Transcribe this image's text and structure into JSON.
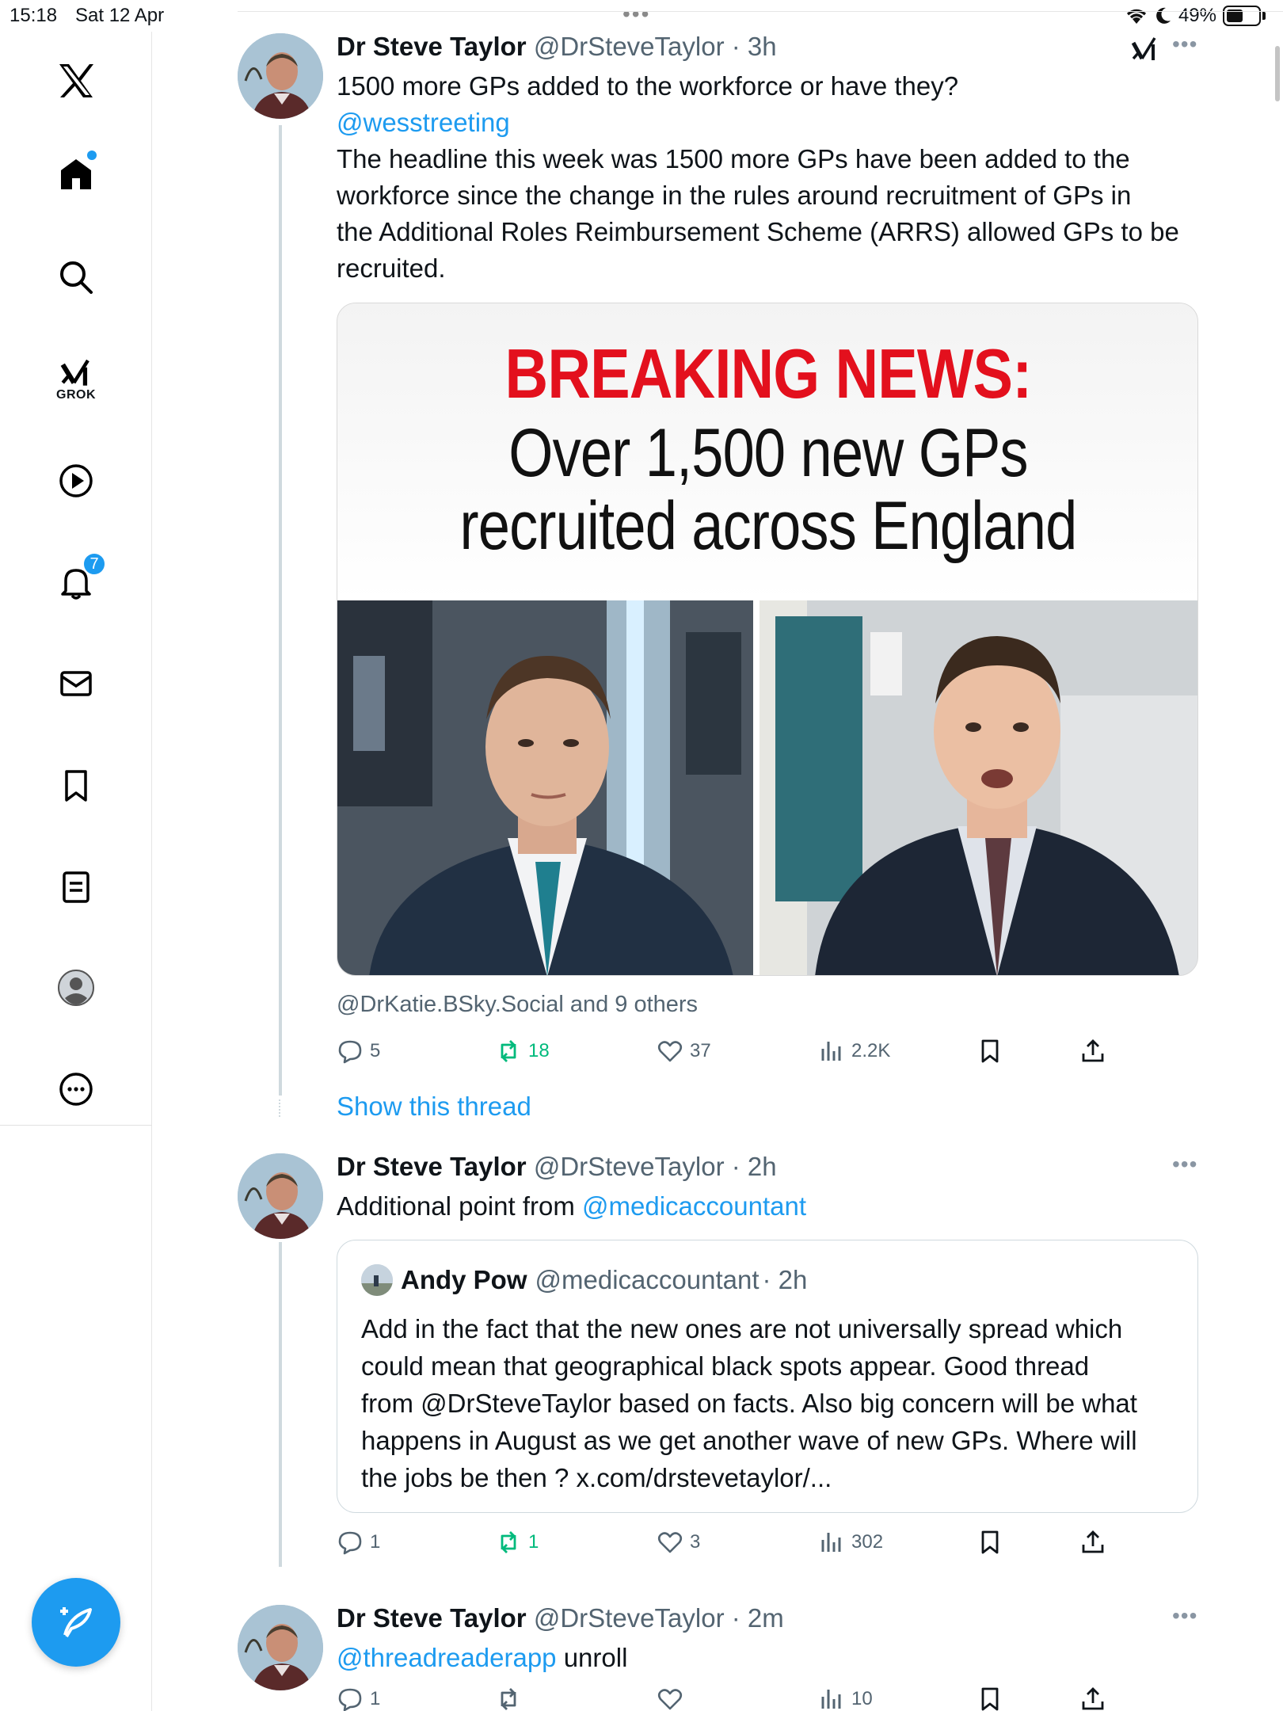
{
  "status_bar": {
    "time": "15:18",
    "date": "Sat 12 Apr",
    "battery": "49%"
  },
  "sidebar": {
    "grok_label": "GROK",
    "notifications_count": "7",
    "accent": "#1d9bf0"
  },
  "tweets": [
    {
      "name": "Dr Steve Taylor",
      "handle": "@DrSteveTaylor",
      "time": "· 3h",
      "line1": "1500 more GPs added to the workforce or have they?",
      "mention": "@wesstreeting",
      "body_lines": [
        "The headline this week was 1500 more GPs have been added to the",
        "workforce since the change in the rules around recruitment of GPs in",
        "the Additional Roles Reimbursement Scheme (ARRS) allowed GPs to be",
        "recruited."
      ],
      "media": {
        "breaking": "BREAKING NEWS:",
        "headline1": "Over 1,500 new GPs",
        "headline2": "recruited across England"
      },
      "caption": "@DrKatie.BSky.Social and 9 others",
      "replies": "5",
      "reposts": "18",
      "likes": "37",
      "views": "2.2K",
      "show_thread": "Show this thread"
    },
    {
      "name": "Dr Steve Taylor",
      "handle": "@DrSteveTaylor",
      "time": "· 2h",
      "text_prefix": "Additional point from ",
      "mention": "@medicaccountant",
      "quote": {
        "name": "Andy Pow",
        "handle": "@medicaccountant",
        "time": "· 2h",
        "lines": [
          "Add in the fact that the new ones are not universally spread which",
          "could mean that geographical black spots appear. Good thread",
          "from @DrSteveTaylor based on facts. Also big concern will be what",
          "happens in August as we get another wave of new GPs. Where will",
          "the jobs be then ? x.com/drstevetaylor/..."
        ]
      },
      "replies": "1",
      "reposts": "1",
      "likes": "3",
      "views": "302"
    },
    {
      "name": "Dr Steve Taylor",
      "handle": "@DrSteveTaylor",
      "time": "· 2m",
      "mention": "@threadreaderapp",
      "text_suffix": " unroll",
      "replies": "1",
      "views": "10"
    }
  ]
}
